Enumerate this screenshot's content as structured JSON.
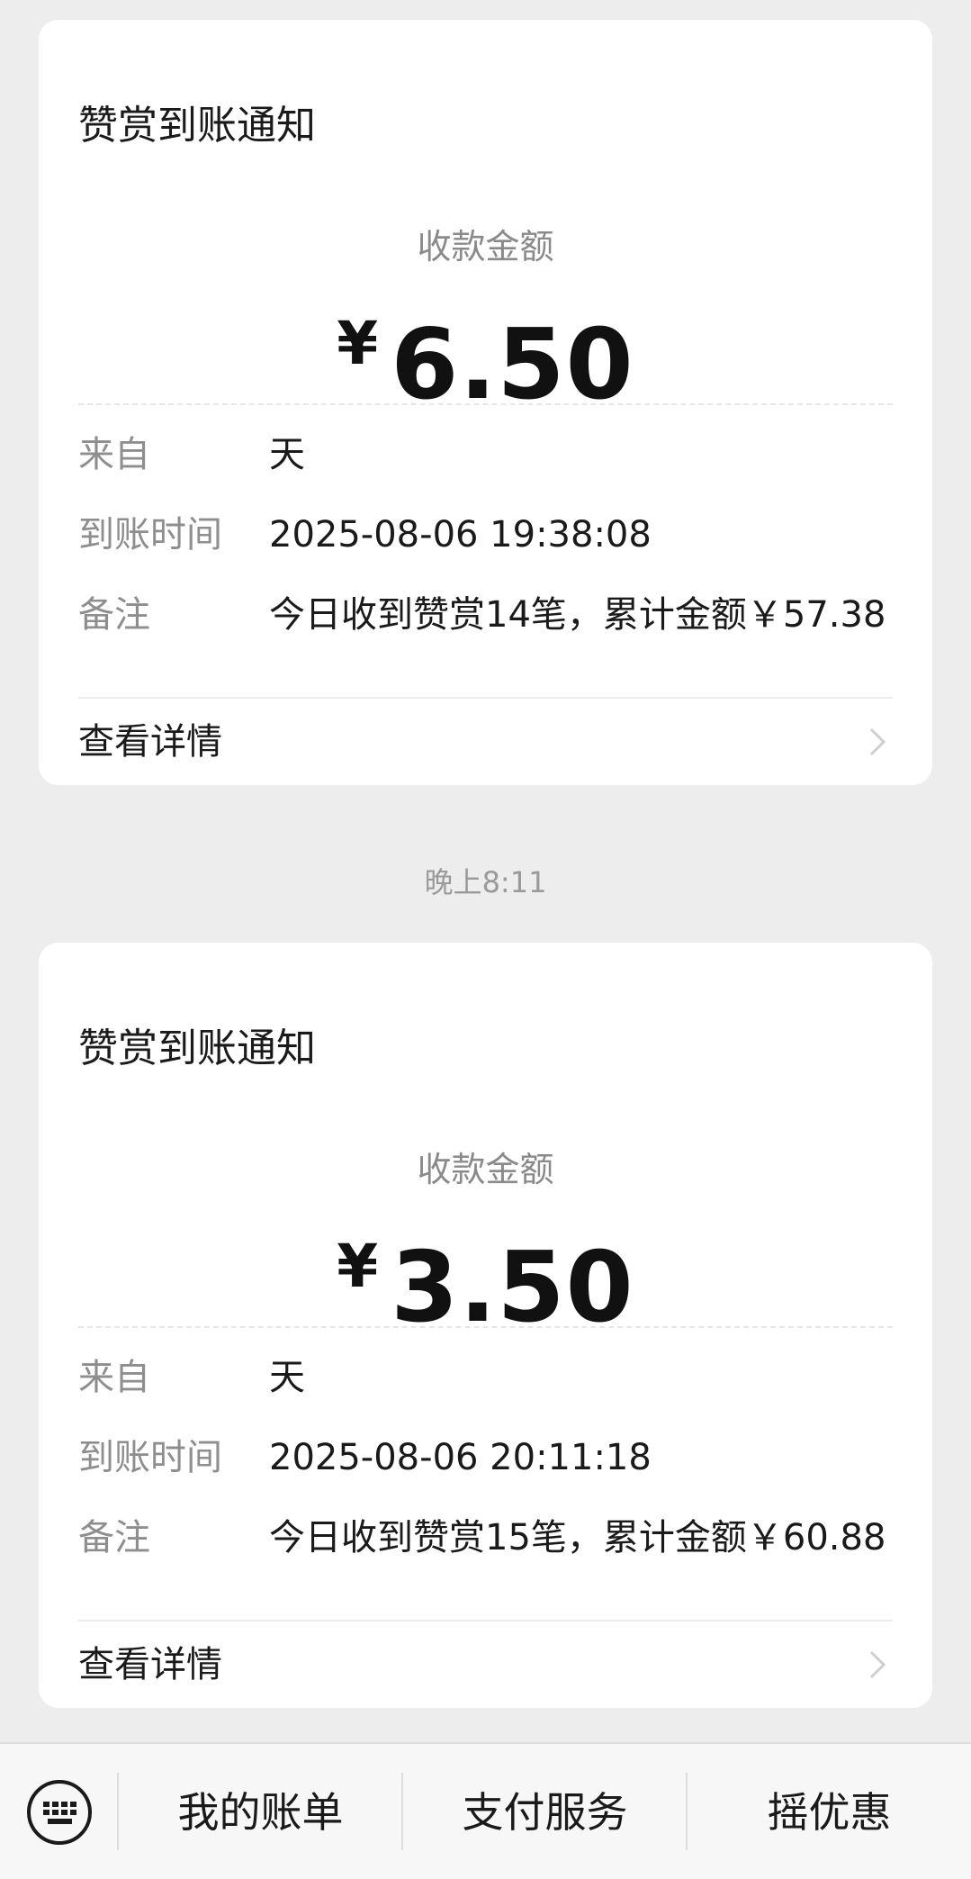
{
  "cards": [
    {
      "title": "赞赏到账通知",
      "amount_label": "收款金额",
      "currency": "¥",
      "amount": "6.50",
      "from_label": "来自",
      "from_value": "天",
      "time_label": "到账时间",
      "time_value": "2025-08-06 19:38:08",
      "note_label": "备注",
      "note_value": "今日收到赞赏14笔，累计金额￥57.38",
      "detail_label": "查看详情"
    },
    {
      "title": "赞赏到账通知",
      "amount_label": "收款金额",
      "currency": "¥",
      "amount": "3.50",
      "from_label": "来自",
      "from_value": "天",
      "time_label": "到账时间",
      "time_value": "2025-08-06 20:11:18",
      "note_label": "备注",
      "note_value": "今日收到赞赏15笔，累计金额￥60.88",
      "detail_label": "查看详情"
    }
  ],
  "timestamp": "晚上8:11",
  "bottom_bar": {
    "keyboard_icon": "keyboard-icon",
    "items": [
      "我的账单",
      "支付服务",
      "摇优惠"
    ]
  },
  "colors": {
    "background": "#ededed",
    "card": "#ffffff",
    "text_primary": "#1a1a1a",
    "text_secondary": "#8e8e8e"
  }
}
